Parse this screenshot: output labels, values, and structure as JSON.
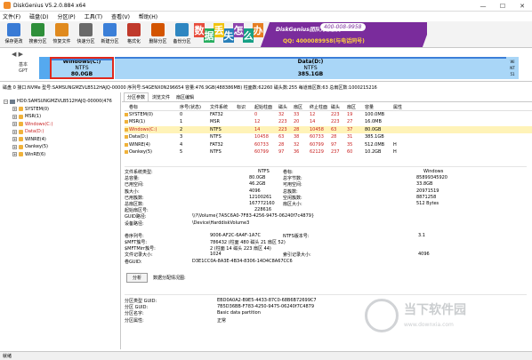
{
  "window": {
    "title": "DiskGenius V5.2.0.884 x64",
    "minimize": "—",
    "maximize": "☐",
    "close": "✕"
  },
  "menu": [
    "文件(F)",
    "磁盘(D)",
    "分区(P)",
    "工具(T)",
    "查看(V)",
    "帮助(H)"
  ],
  "toolbar": [
    {
      "label": "保存更改",
      "icon": "save-icon",
      "color": "#3a7bd5"
    },
    {
      "label": "搜索分区",
      "icon": "search-partition-icon",
      "color": "#2f8f3a"
    },
    {
      "label": "恢复文件",
      "icon": "recover-files-icon",
      "color": "#e08a1e"
    },
    {
      "label": "快速分区",
      "icon": "quick-partition-icon",
      "color": "#6a6a6a"
    },
    {
      "label": "新建分区",
      "icon": "new-partition-icon",
      "color": "#3b7fd8"
    },
    {
      "label": "格式化",
      "icon": "format-icon",
      "color": "#c0392b"
    },
    {
      "label": "删除分区",
      "icon": "delete-partition-icon",
      "color": "#d35400"
    },
    {
      "label": "备份分区",
      "icon": "backup-partition-icon",
      "color": "#2e86c1"
    }
  ],
  "banner": {
    "chars": [
      {
        "ch": "数",
        "bg": "#e74c3c"
      },
      {
        "ch": "据",
        "bg": "#27ae60"
      },
      {
        "ch": "丢",
        "bg": "#f1c40f"
      },
      {
        "ch": "失",
        "bg": "#2980b9"
      },
      {
        "ch": "怎",
        "bg": "#8e44ad"
      },
      {
        "ch": "么",
        "bg": "#16a085"
      },
      {
        "ch": "办",
        "bg": "#e67e22"
      }
    ],
    "line1": "DiskGenius团队为您服务",
    "line2": "400-008-9958",
    "line3": "QQ: 4000089958(与电话同号)"
  },
  "diskmap": {
    "nav_arrows": "◀ ▶",
    "disk_label_1": "基本",
    "disk_label_2": "GPT",
    "partitions": [
      {
        "name": "Windows(C:)",
        "fs": "NTFS",
        "size": "80.0GB"
      },
      {
        "name": "Data(D:)",
        "fs": "NTFS",
        "size": "385.1GB"
      },
      {
        "name": "Wi",
        "fs": "NT",
        "size": "51"
      }
    ]
  },
  "disk_info": "磁盘 0 接口:NVMe  型号:SAMSUNGMZVLB512HAJQ-00000  序列号:S4GENX0N296654  容量:476.9GB(488386MB)  柱面数:62260  磁头数:255  每道扇区数:63  总扇区数:1000215216",
  "tree": [
    {
      "label": "HD0:SAMSUNGMZVLB512HAJQ-00000(476",
      "type": "disk",
      "indent": 0,
      "color": "#000"
    },
    {
      "label": "SYSTEM(0)",
      "type": "part",
      "indent": 1,
      "color": "#000"
    },
    {
      "label": "MSR(1)",
      "type": "part",
      "indent": 1,
      "color": "#000"
    },
    {
      "label": "Windows(C:)",
      "type": "part",
      "indent": 1,
      "color": "#c81e1e"
    },
    {
      "label": "Data(D:)",
      "type": "part",
      "indent": 1,
      "color": "#c81e1e"
    },
    {
      "label": "WINRE(4)",
      "type": "part",
      "indent": 1,
      "color": "#000"
    },
    {
      "label": "Oankey(5)",
      "type": "part",
      "indent": 1,
      "color": "#000"
    },
    {
      "label": "WinRE(6)",
      "type": "part",
      "indent": 1,
      "color": "#000"
    }
  ],
  "tabs": [
    "分区参数",
    "浏览文件",
    "扇区编辑"
  ],
  "partition_table": {
    "headers": [
      "卷标",
      "序号(状态)",
      "文件系统",
      "标识",
      "起始柱面",
      "磁头",
      "扇区",
      "终止柱面",
      "磁头",
      "扇区",
      "容量",
      "属性"
    ],
    "rows": [
      [
        "SYSTEM(0)",
        "0",
        "FAT32",
        "",
        "0",
        "32",
        "33",
        "12",
        "223",
        "19",
        "100.0MB",
        ""
      ],
      [
        "MSR(1)",
        "1",
        "MSR",
        "",
        "12",
        "223",
        "20",
        "14",
        "223",
        "27",
        "16.0MB",
        ""
      ],
      [
        "Windows(C:)",
        "2",
        "NTFS",
        "",
        "14",
        "223",
        "28",
        "10458",
        "63",
        "37",
        "80.0GB",
        ""
      ],
      [
        "Data(D:)",
        "3",
        "NTFS",
        "",
        "10458",
        "63",
        "38",
        "60733",
        "28",
        "31",
        "385.1GB",
        ""
      ],
      [
        "WINRE(4)",
        "4",
        "FAT32",
        "",
        "60733",
        "28",
        "32",
        "60799",
        "97",
        "35",
        "512.0MB",
        "H"
      ],
      [
        "Oankey(5)",
        "5",
        "NTFS",
        "",
        "60799",
        "97",
        "36",
        "62129",
        "237",
        "60",
        "10.2GB",
        "H"
      ]
    ]
  },
  "details": {
    "fs_type_label": "文件系统类型:",
    "fs_type": "NTFS",
    "volume_label_label": "卷标:",
    "volume_label": "Windows",
    "rows_a": [
      [
        "总容量:",
        "80.0GB",
        "总字节数:",
        "85899345920"
      ],
      [
        "已用空间:",
        "46.2GB",
        "可用空间:",
        "33.8GB"
      ],
      [
        "簇大小:",
        "4096",
        "总簇数:",
        "20971519"
      ],
      [
        "已用簇数:",
        "12100261",
        "空闲簇数:",
        "8871258"
      ],
      [
        "总扇区数:",
        "167772160",
        "扇区大小:",
        "512 Bytes"
      ]
    ],
    "start_sector_label": "起始扇区号:",
    "start_sector": "228616",
    "vol_path_label": "GUID路径:",
    "vol_path": "\\\\?\\Volume{7A5C6A0-7F83-4256-9475-06240f7c4879}",
    "dev_path_label": "设备路径:",
    "dev_path": "\\Device\\HarddiskVolume3",
    "rows_b": [
      [
        "卷序列号:",
        "9006-AF2C-6A4F-1A7C",
        "NTFS版本号:",
        "3.1"
      ],
      [
        "$MFT簇号:",
        "786432 (柱面 480 磁头 21 扇区 52)",
        "",
        ""
      ],
      [
        "$MFTMirr簇号:",
        "2 (柱面 14 磁头 223 扇区 44)",
        "",
        ""
      ],
      [
        "文件记录大小:",
        "1024",
        "索引记录大小:",
        "4096"
      ]
    ],
    "vol_guid_label": "卷GUID:",
    "vol_guid": "D3E1CC0A-8A3E-4B34-8306-14D4C8A67CC6"
  },
  "analyze": {
    "button": "分析",
    "label": "数据分配情况图:"
  },
  "guid_rows": [
    [
      "分区类型 GUID:",
      "EBD0A0A2-B9E5-4433-87C0-68B6B72699C7"
    ],
    [
      "分区 GUID:",
      "7B5D36BB-F783-4250-9475-06240f7C4879"
    ],
    [
      "分区名字:",
      "Basic data partition"
    ],
    [
      "分区属性:",
      "正常"
    ]
  ],
  "watermark": {
    "line1": "当下软件园",
    "line2": "www.downxia.com"
  },
  "status": "就绪"
}
